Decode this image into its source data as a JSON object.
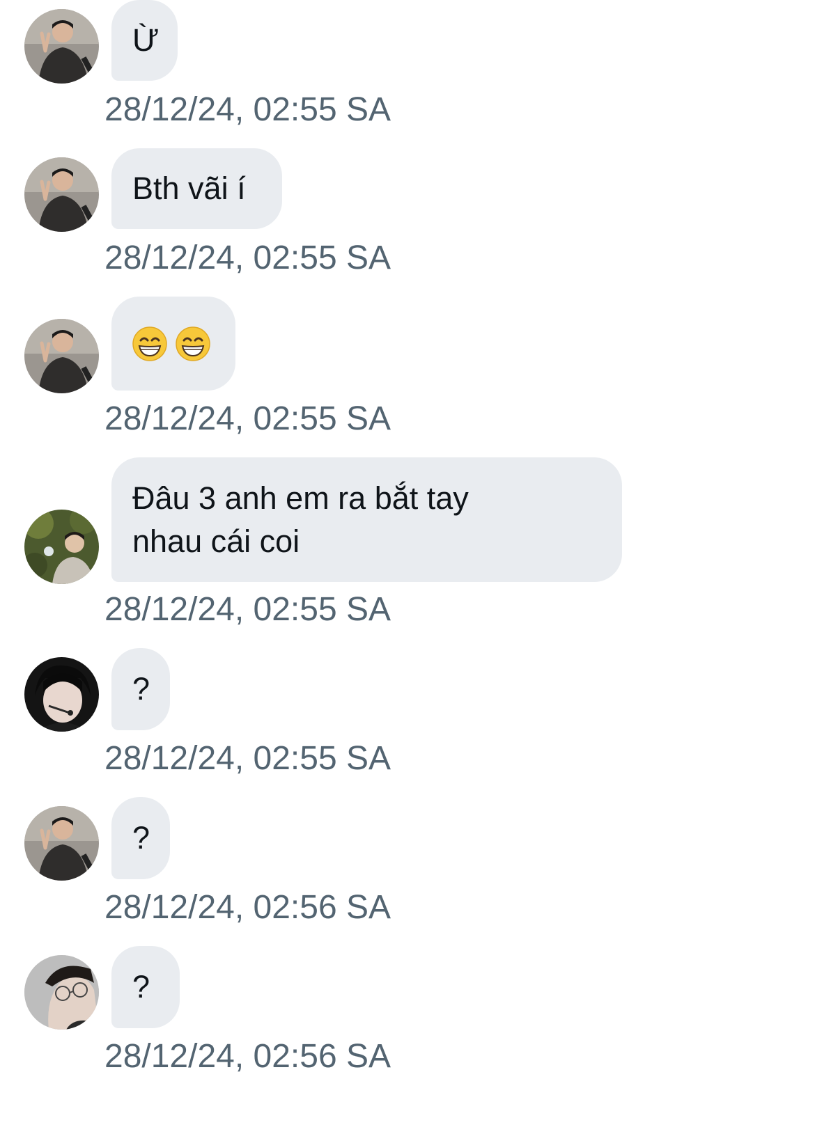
{
  "messages": [
    {
      "sender_avatar": "avatar-peace-sign-man",
      "text": "Ừ",
      "timestamp": "28/12/24, 02:55 SA"
    },
    {
      "sender_avatar": "avatar-peace-sign-man",
      "text": "Bth vãi í",
      "timestamp": "28/12/24, 02:55 SA"
    },
    {
      "sender_avatar": "avatar-peace-sign-man",
      "emojis": [
        "grinning-face-with-smiling-eyes-icon",
        "grinning-face-with-smiling-eyes-icon"
      ],
      "timestamp": "28/12/24, 02:55 SA"
    },
    {
      "sender_avatar": "avatar-outdoor-person",
      "text": "Đâu 3 anh em ra bắt tay nhau cái coi",
      "timestamp": "28/12/24, 02:55 SA"
    },
    {
      "sender_avatar": "avatar-headset-person",
      "text": "?",
      "timestamp": "28/12/24, 02:55 SA"
    },
    {
      "sender_avatar": "avatar-peace-sign-man",
      "text": "?",
      "timestamp": "28/12/24, 02:56 SA"
    },
    {
      "sender_avatar": "avatar-glasses-person",
      "text": "?",
      "timestamp": "28/12/24, 02:56 SA"
    }
  ],
  "colors": {
    "bubble_bg": "#e9ecf0",
    "text": "#0f1419",
    "timestamp": "#536471",
    "background": "#ffffff"
  }
}
